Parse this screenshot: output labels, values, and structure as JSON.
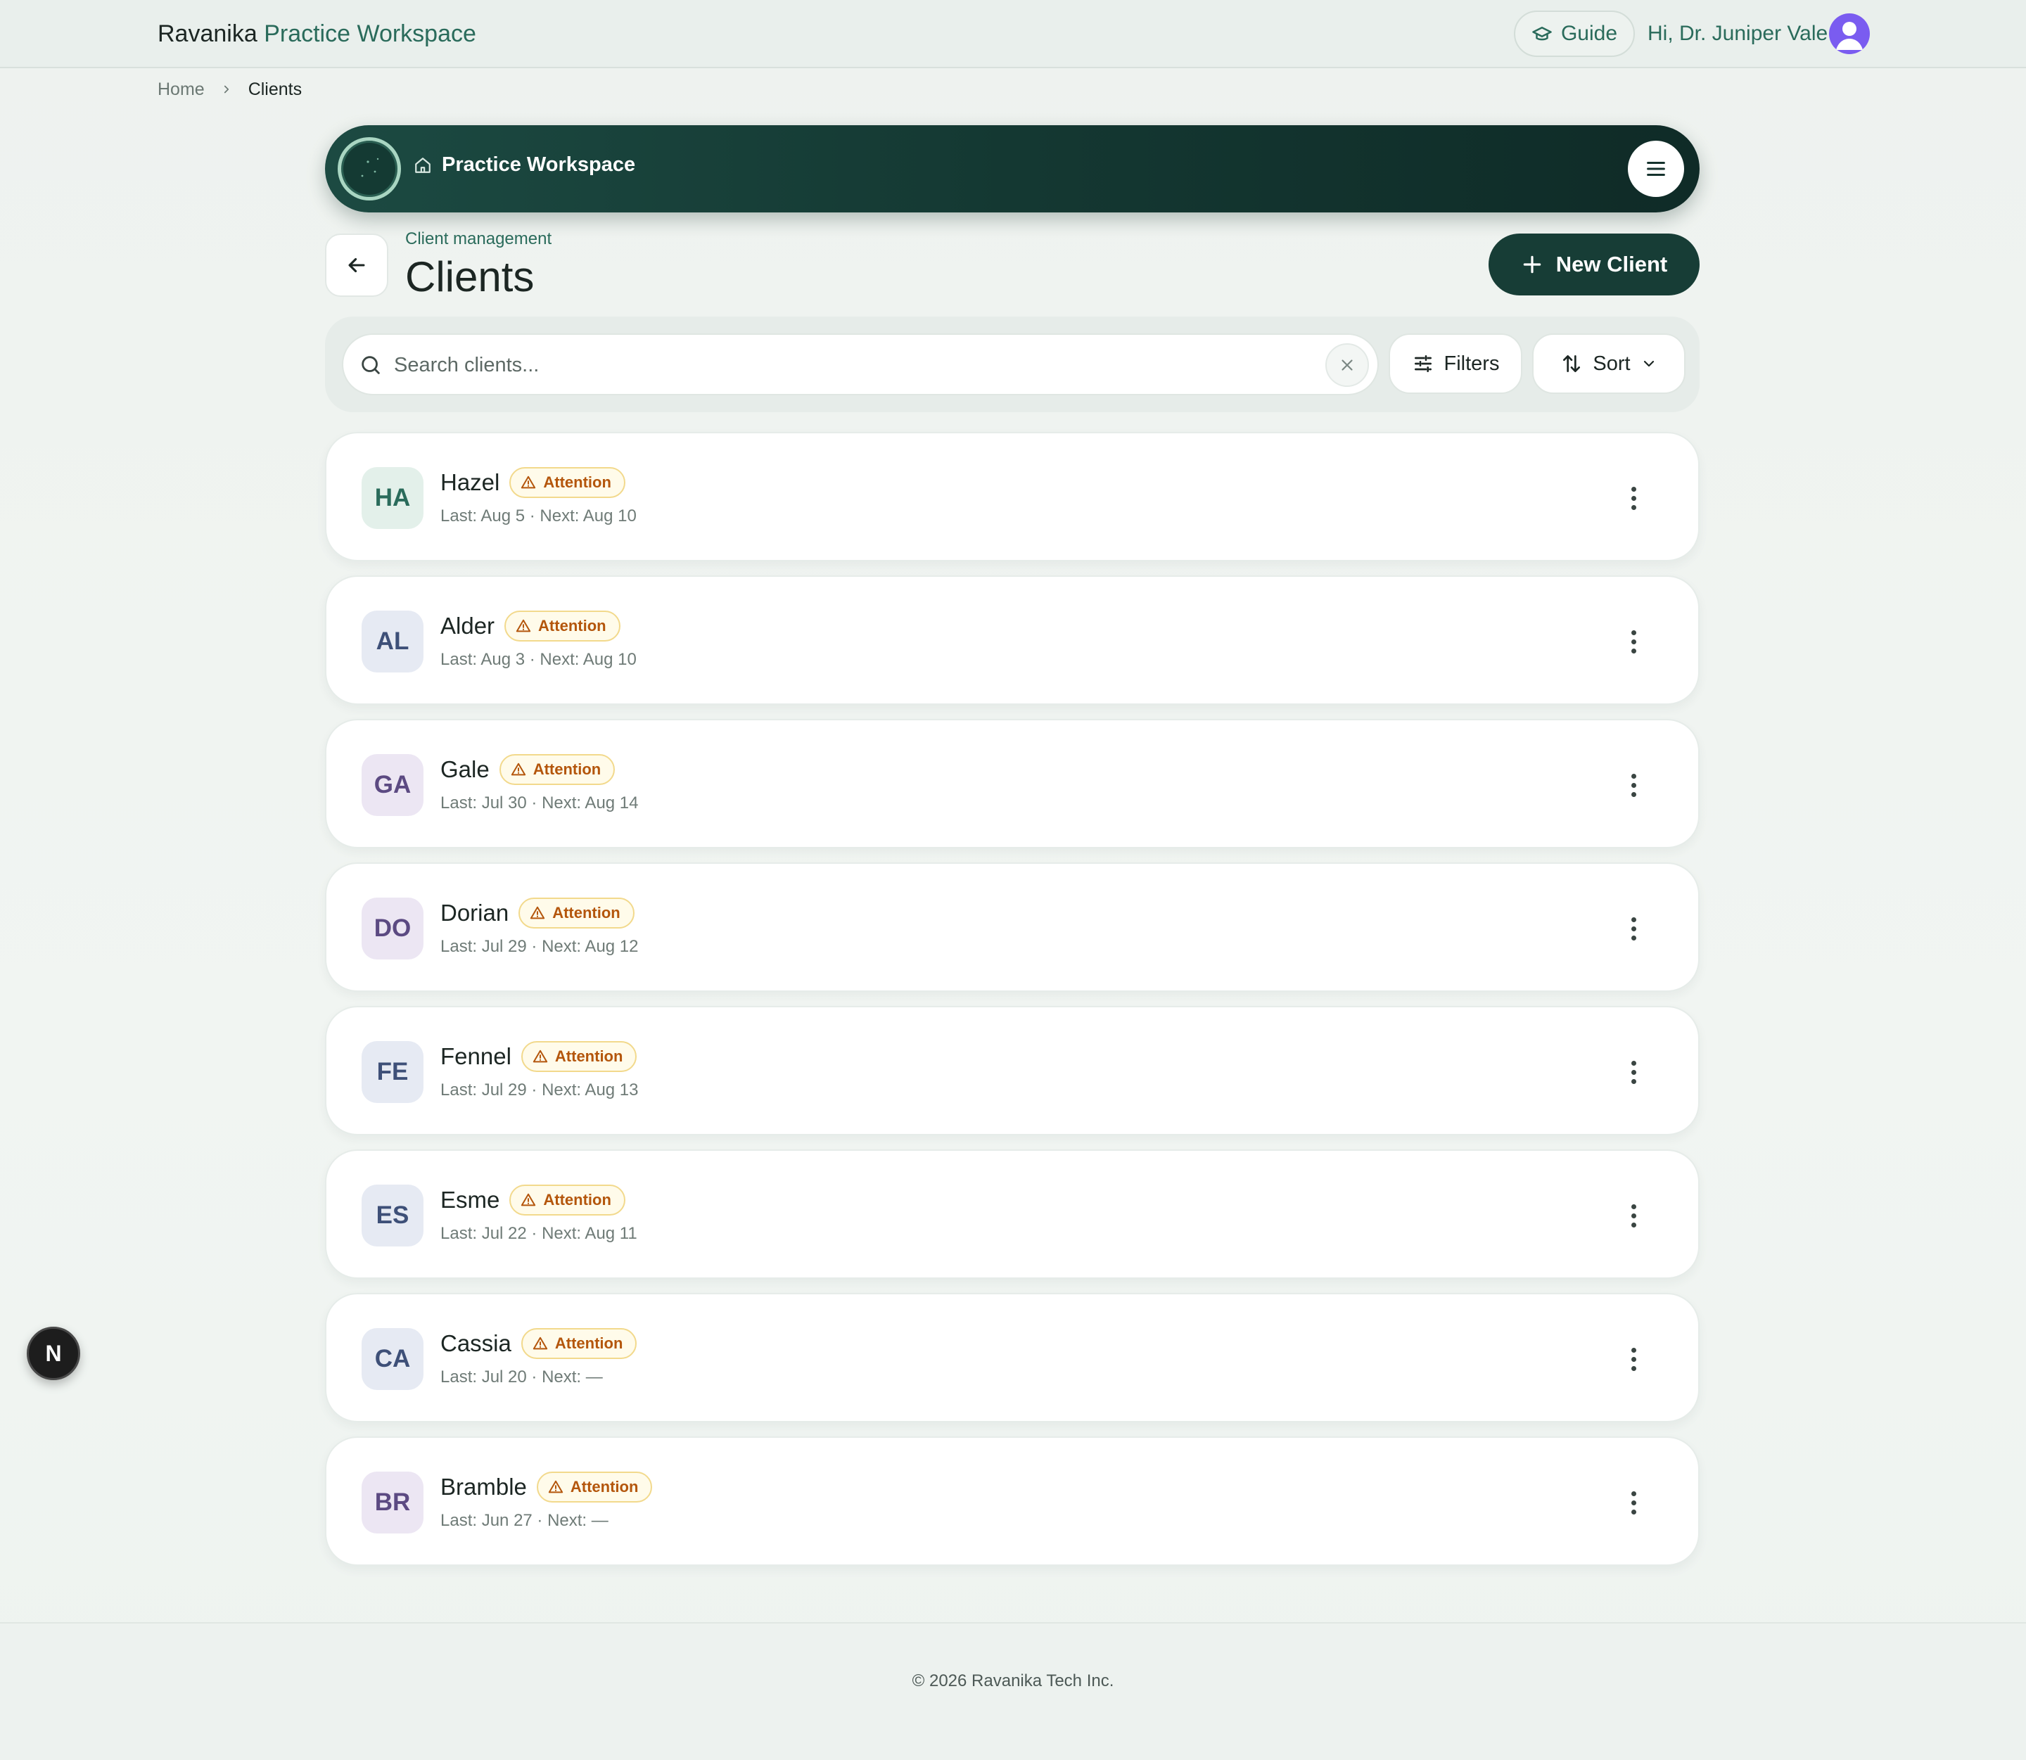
{
  "app": {
    "brand_primary": "Ravanika",
    "brand_secondary": "Practice Workspace",
    "guide_label": "Guide",
    "greeting": "Hi, Dr. Juniper Vale"
  },
  "breadcrumb": {
    "home": "Home",
    "current": "Clients"
  },
  "workspace": {
    "title": "Practice Workspace"
  },
  "page": {
    "eyebrow": "Client management",
    "title": "Clients",
    "new_client_label": "New Client"
  },
  "toolbar": {
    "search_placeholder": "Search clients...",
    "search_value": "",
    "filters_label": "Filters",
    "sort_label": "Sort"
  },
  "clients": [
    {
      "initials": "HA",
      "name": "Hazel",
      "badge": "Attention",
      "visits": "Last: Aug 5 · Next: Aug 10",
      "avatar_bg": "#e3f0ea",
      "avatar_fg": "#2a6b5b"
    },
    {
      "initials": "AL",
      "name": "Alder",
      "badge": "Attention",
      "visits": "Last: Aug 3 · Next: Aug 10",
      "avatar_bg": "#e6eaf3",
      "avatar_fg": "#3e5078"
    },
    {
      "initials": "GA",
      "name": "Gale",
      "badge": "Attention",
      "visits": "Last: Jul 30 · Next: Aug 14",
      "avatar_bg": "#ece6f3",
      "avatar_fg": "#5c4a82"
    },
    {
      "initials": "DO",
      "name": "Dorian",
      "badge": "Attention",
      "visits": "Last: Jul 29 · Next: Aug 12",
      "avatar_bg": "#ece6f3",
      "avatar_fg": "#5c4a82"
    },
    {
      "initials": "FE",
      "name": "Fennel",
      "badge": "Attention",
      "visits": "Last: Jul 29 · Next: Aug 13",
      "avatar_bg": "#e6eaf3",
      "avatar_fg": "#3e5078"
    },
    {
      "initials": "ES",
      "name": "Esme",
      "badge": "Attention",
      "visits": "Last: Jul 22 · Next: Aug 11",
      "avatar_bg": "#e6eaf3",
      "avatar_fg": "#3e5078"
    },
    {
      "initials": "CA",
      "name": "Cassia",
      "badge": "Attention",
      "visits": "Last: Jul 20 · Next: —",
      "avatar_bg": "#e6eaf3",
      "avatar_fg": "#3e5078"
    },
    {
      "initials": "BR",
      "name": "Bramble",
      "badge": "Attention",
      "visits": "Last: Jun 27 · Next: —",
      "avatar_bg": "#ece6f3",
      "avatar_fg": "#5c4a82"
    }
  ],
  "floating_badge": "N",
  "footer": {
    "copyright": "© 2026 Ravanika Tech Inc."
  },
  "colors": {
    "brand_green": "#2a6b5b",
    "workspace_bar": "#143832",
    "primary_button": "#173d36",
    "attention_text": "#b4560c",
    "attention_bg": "#fffbea",
    "avatar_purple": "#7a5cf0"
  },
  "icons": {
    "guide": "graduation-cap-icon",
    "workspace": "home-icon",
    "menu": "hamburger-menu-icon",
    "back": "arrow-left-icon",
    "new_client": "plus-icon",
    "search": "search-icon",
    "clear": "close-icon",
    "filters": "sliders-icon",
    "sort": "sort-arrows-icon",
    "badge": "warning-triangle-icon",
    "row_menu": "more-vertical-icon"
  }
}
